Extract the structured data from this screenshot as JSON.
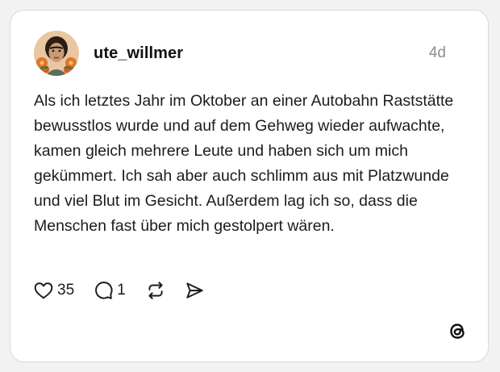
{
  "post": {
    "username": "ute_willmer",
    "time": "4d",
    "text": "Als ich letztes Jahr im Oktober an einer Autobahn Raststätte bewusstlos wurde und auf dem Gehweg wieder aufwachte, kamen gleich mehrere Leute und haben sich um mich gekümmert. Ich sah aber auch schlimm aus mit Platzwunde und viel Blut im Gesicht. Außerdem lag ich so, dass die Menschen fast über mich gestolpert wären.",
    "avatar_icon": "avatar-portrait-icon"
  },
  "actions": {
    "likes": "35",
    "replies": "1",
    "like_icon": "heart-icon",
    "reply_icon": "comment-icon",
    "repost_icon": "repost-icon",
    "share_icon": "send-icon"
  },
  "brand": {
    "logo_icon": "threads-logo-icon"
  },
  "colors": {
    "text": "#1c1c1c",
    "muted": "#8e8e8e",
    "card_bg": "#ffffff",
    "card_border": "#d9d9d9",
    "page_bg": "#f2f2f2"
  }
}
